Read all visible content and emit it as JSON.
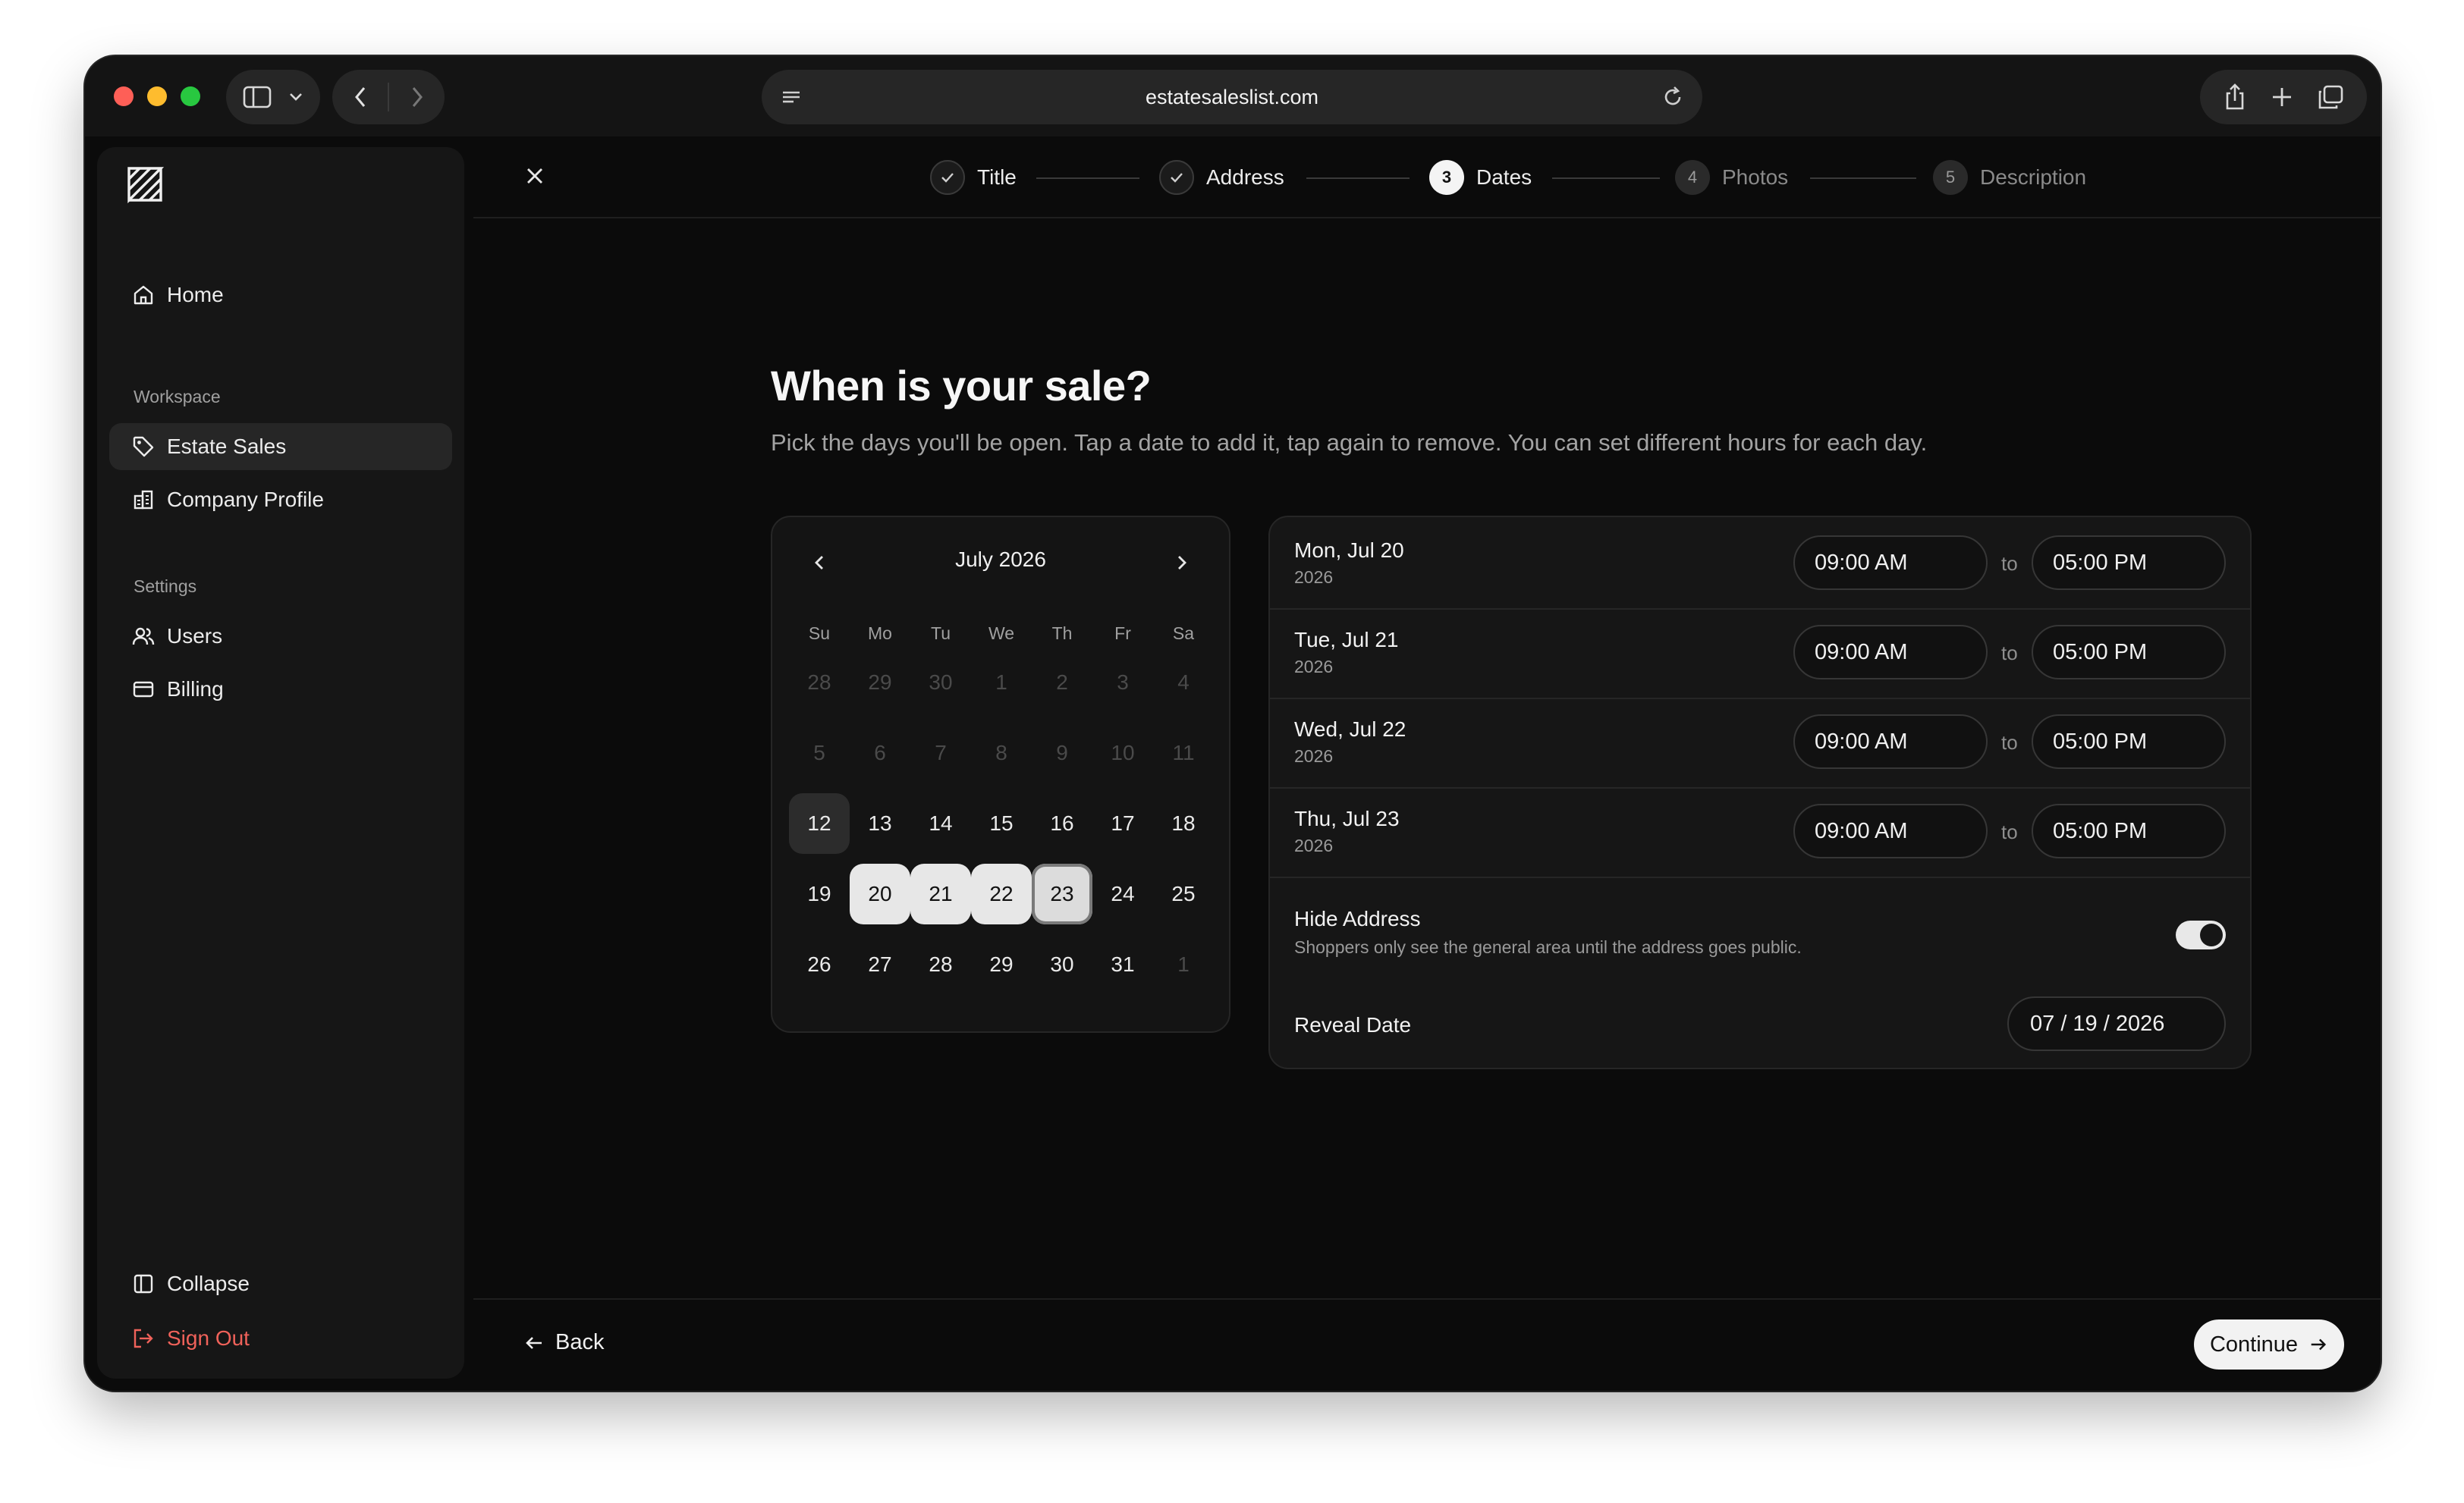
{
  "browser": {
    "url": "estatesaleslist.com"
  },
  "sidebar": {
    "home_label": "Home",
    "workspace_label": "Workspace",
    "estate_sales_label": "Estate Sales",
    "company_profile_label": "Company Profile",
    "settings_label": "Settings",
    "users_label": "Users",
    "billing_label": "Billing",
    "collapse_label": "Collapse",
    "signout_label": "Sign Out"
  },
  "stepper": {
    "steps": [
      {
        "num": "1",
        "label": "Title",
        "state": "done"
      },
      {
        "num": "2",
        "label": "Address",
        "state": "done"
      },
      {
        "num": "3",
        "label": "Dates",
        "state": "current"
      },
      {
        "num": "4",
        "label": "Photos",
        "state": "upcoming"
      },
      {
        "num": "5",
        "label": "Description",
        "state": "upcoming"
      }
    ]
  },
  "main": {
    "title": "When is your sale?",
    "subtitle": "Pick the days you'll be open. Tap a date to add it, tap again to remove. You can set different hours for each day."
  },
  "calendar": {
    "month_label": "July 2026",
    "weekdays": [
      "Su",
      "Mo",
      "Tu",
      "We",
      "Th",
      "Fr",
      "Sa"
    ],
    "weeks": [
      [
        "28",
        "29",
        "30",
        "1",
        "2",
        "3",
        "4"
      ],
      [
        "5",
        "6",
        "7",
        "8",
        "9",
        "10",
        "11"
      ],
      [
        "12",
        "13",
        "14",
        "15",
        "16",
        "17",
        "18"
      ],
      [
        "19",
        "20",
        "21",
        "22",
        "23",
        "24",
        "25"
      ],
      [
        "26",
        "27",
        "28",
        "29",
        "30",
        "31",
        "1"
      ]
    ],
    "today": "12",
    "selected": [
      "20",
      "21",
      "22",
      "23"
    ],
    "focused": "23"
  },
  "schedule": {
    "days": [
      {
        "date": "Mon, Jul 20",
        "year": "2026",
        "start": "09:00 AM",
        "end": "05:00 PM"
      },
      {
        "date": "Tue, Jul 21",
        "year": "2026",
        "start": "09:00 AM",
        "end": "05:00 PM"
      },
      {
        "date": "Wed, Jul 22",
        "year": "2026",
        "start": "09:00 AM",
        "end": "05:00 PM"
      },
      {
        "date": "Thu, Jul 23",
        "year": "2026",
        "start": "09:00 AM",
        "end": "05:00 PM"
      }
    ],
    "to_label": "to",
    "hide_address": {
      "title": "Hide Address",
      "description": "Shoppers only see the general area until the address goes public.",
      "enabled": true
    },
    "reveal_date": {
      "label": "Reveal Date",
      "value": "07 / 19 / 2026"
    }
  },
  "footer": {
    "back_label": "Back",
    "continue_label": "Continue"
  },
  "colors": {
    "accent": "#f2f2f2",
    "background": "#0b0b0b",
    "danger": "#f0625a"
  }
}
